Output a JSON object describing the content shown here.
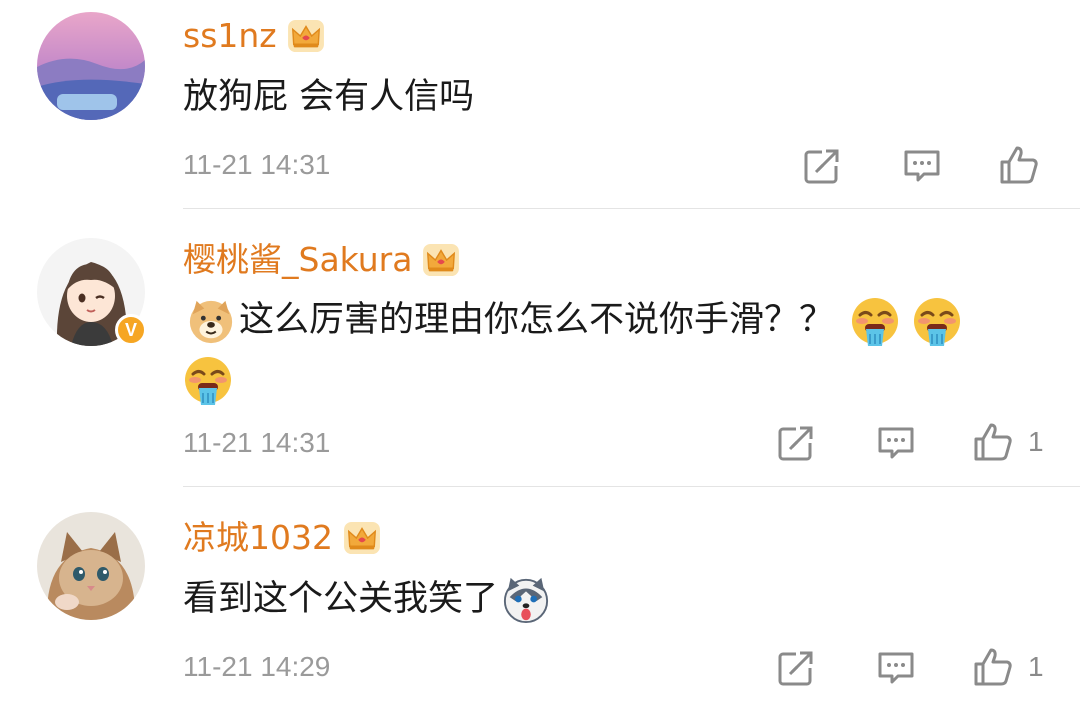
{
  "comments": [
    {
      "username": "ss1nz",
      "text": "放狗屁 会有人信吗",
      "time": "11-21 14:31",
      "likes": "",
      "avatar_icon": "sunset-landscape-avatar"
    },
    {
      "username": "樱桃酱_Sakura",
      "text_before": "这么厉害的理由你怎么不说你手滑？？",
      "time": "11-21 14:31",
      "likes": "1",
      "avatar_icon": "anime-girl-avatar",
      "verified": true
    },
    {
      "username": "凉城1032",
      "text": "看到这个公关我笑了",
      "time": "11-21 14:29",
      "likes": "1",
      "avatar_icon": "kitten-avatar"
    }
  ],
  "colors": {
    "username": "#e07a1f",
    "crown": "#f2a93b",
    "text": "#1a1a1a",
    "meta": "#9a9a9a",
    "icon": "#8a8a8a"
  },
  "icons": [
    "share-icon",
    "comment-icon",
    "like-icon",
    "crown-badge-icon",
    "doge-emoji-icon",
    "vomit-emoji-icon",
    "husky-emoji-icon"
  ]
}
